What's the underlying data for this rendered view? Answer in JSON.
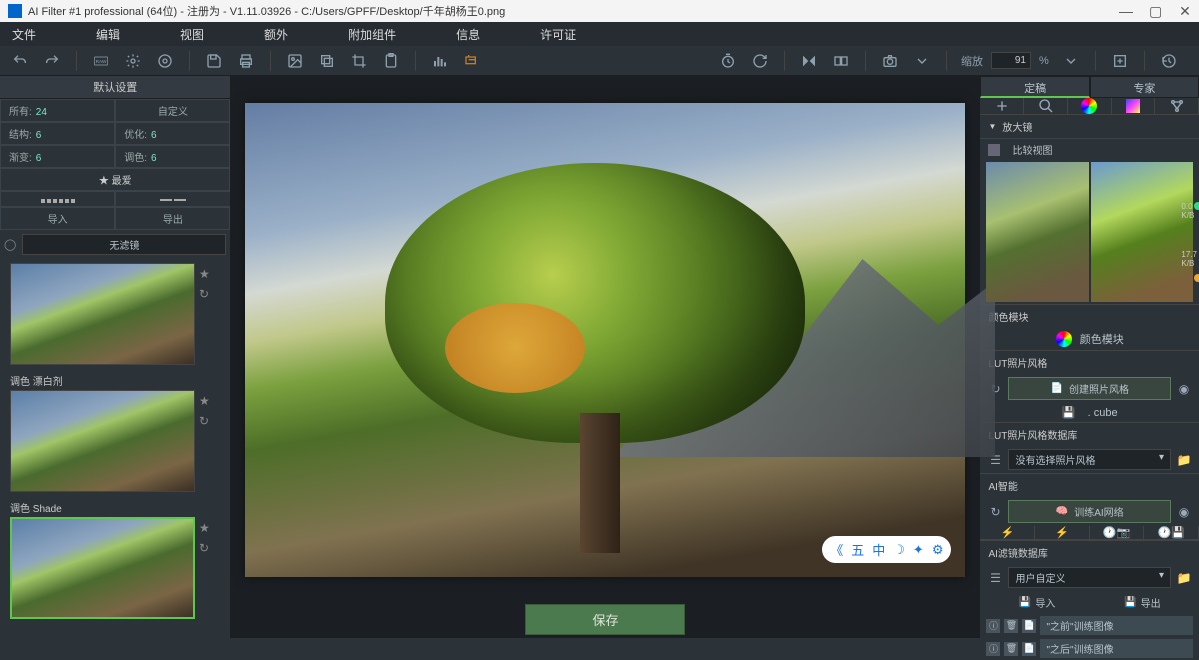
{
  "title": "AI Filter #1 professional (64位) - 注册为 - V1.11.03926 - C:/Users/GPFF/Desktop/千年胡杨王0.png",
  "menu": {
    "file": "文件",
    "edit": "编辑",
    "view": "视图",
    "extra": "额外",
    "addons": "附加组件",
    "info": "信息",
    "license": "许可证"
  },
  "toolbar": {
    "zoom_label": "缩放",
    "zoom_val": "91",
    "zoom_pct": "%"
  },
  "left": {
    "presets": "默认设置",
    "all": "所有:",
    "all_n": "24",
    "custom": "自定义",
    "struct": "结构:",
    "struct_n": "6",
    "opt": "优化:",
    "opt_n": "6",
    "grad": "渐变:",
    "grad_n": "6",
    "tone": "调色:",
    "tone_n": "6",
    "fav": "★ 最爱",
    "import": "导入",
    "export": "导出",
    "nofilter": "无滤镜",
    "t2": "调色  漂白剂",
    "t3": "调色  Shade"
  },
  "center": {
    "save": "保存",
    "ov1": "五",
    "ov2": "中"
  },
  "right": {
    "tab1": "定稿",
    "tab2": "专家",
    "magnifier": "放大镜",
    "compare": "比较视图",
    "v0": "0.0",
    "v0u": "K/B",
    "v1": "17.7",
    "v1u": "K/B",
    "colmod": "颜色模块",
    "colmod_btn": "颜色模块",
    "lut": "LUT照片风格",
    "create_lut": "创建照片风格",
    "cube": ". cube",
    "lutdb": "LUT照片风格数据库",
    "no_lut": "没有选择照片风格",
    "ai": "AI智能",
    "train": "训练AI网络",
    "aidb": "AI滤镜数据库",
    "usercustom": "用户自定义",
    "import": "导入",
    "export": "导出",
    "before": "\"之前\"训练图像",
    "after": "\"之后\"训练图像"
  }
}
